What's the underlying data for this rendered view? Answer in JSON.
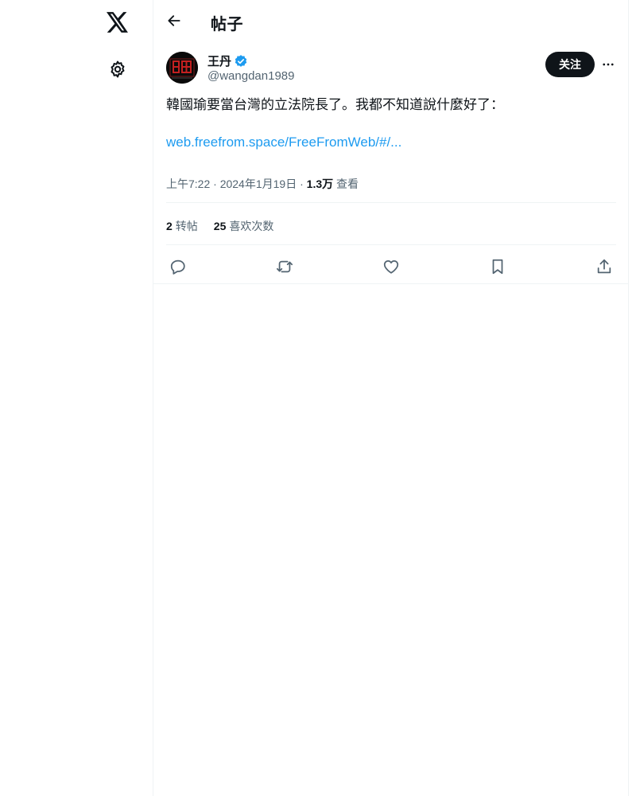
{
  "header": {
    "title": "帖子"
  },
  "post": {
    "author": {
      "name": "王丹",
      "handle": "@wangdan1989",
      "verified": true
    },
    "follow_label": "关注",
    "text": "韓國瑜要當台灣的立法院長了。我都不知道說什麼好了：",
    "link": "web.freefrom.space/FreeFromWeb/#/...",
    "time": "上午7:22",
    "separator": "·",
    "date": "2024年1月19日",
    "views_count": "1.3万",
    "views_label": "查看",
    "reposts_count": "2",
    "reposts_label": "转帖",
    "likes_count": "25",
    "likes_label": "喜欢次数"
  },
  "colors": {
    "accent": "#1d9bf0",
    "text": "#0f1419",
    "secondary": "#536471",
    "border": "#eff3f4"
  },
  "icons": {
    "logo": "x-logo-icon",
    "settings": "gear-icon",
    "back": "arrow-left-icon",
    "verified": "verified-badge-icon",
    "more": "more-horizontal-icon",
    "reply": "reply-icon",
    "repost": "repost-icon",
    "like": "heart-icon",
    "bookmark": "bookmark-icon",
    "share": "share-icon"
  }
}
